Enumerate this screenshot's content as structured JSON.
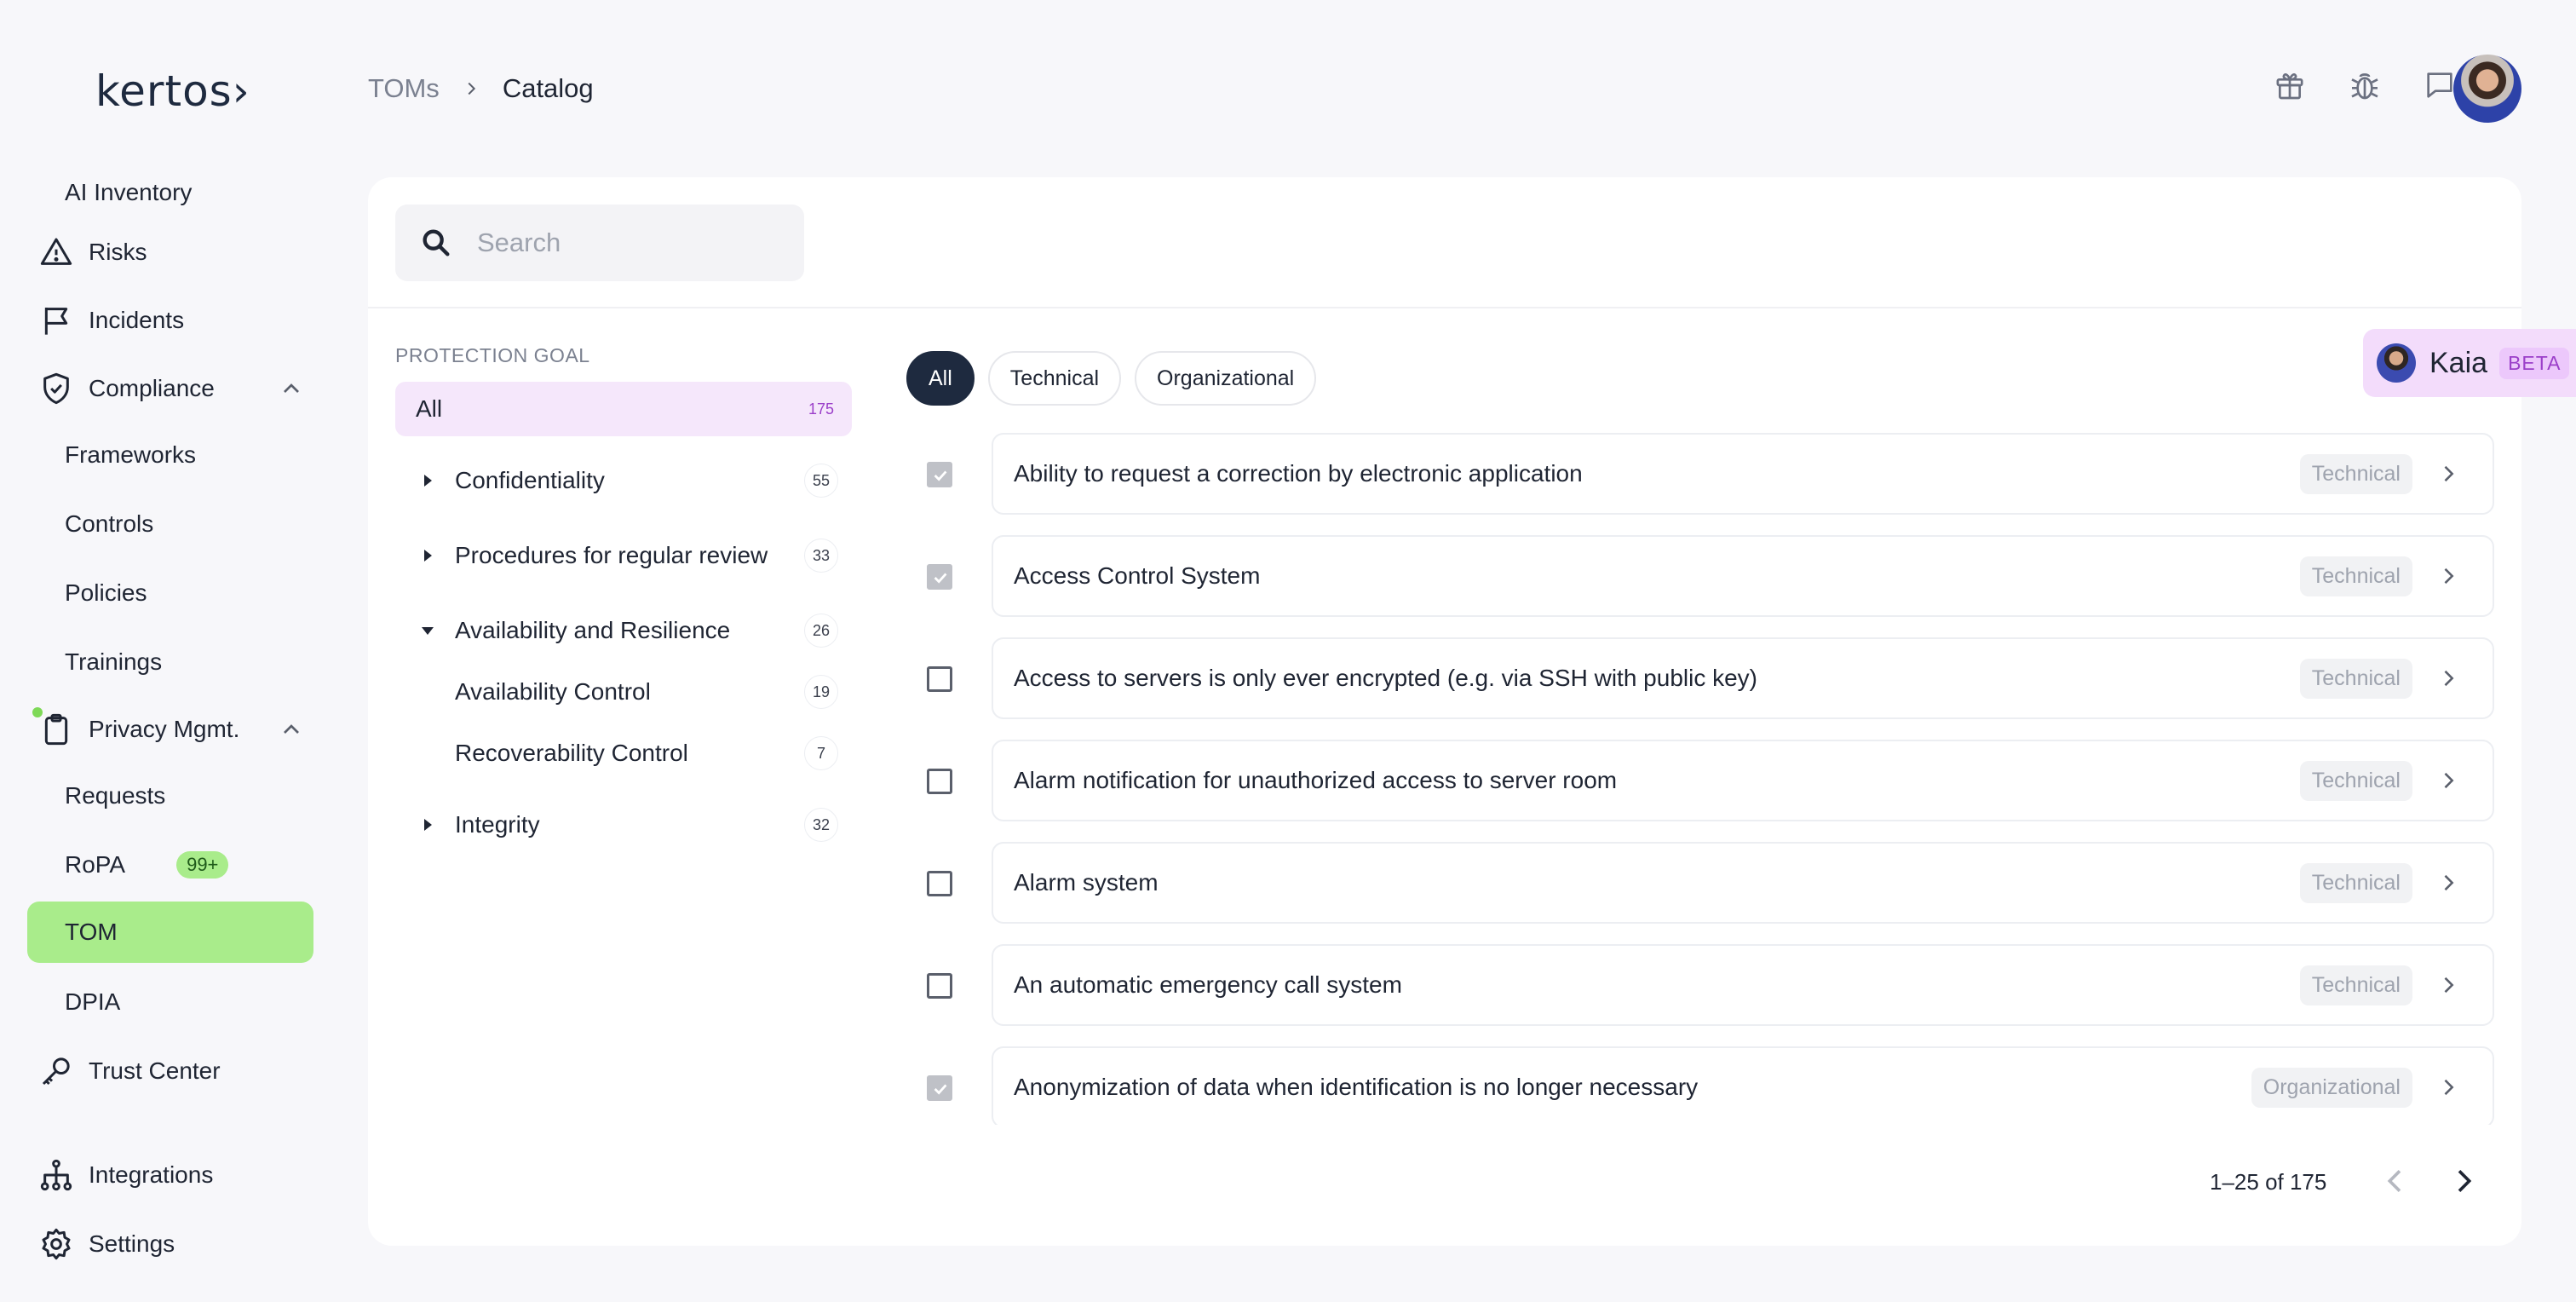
{
  "app": {
    "logo": "kertos›"
  },
  "sidebar": {
    "items": [
      {
        "label": "AI Inventory"
      },
      {
        "label": "Risks"
      },
      {
        "label": "Incidents"
      },
      {
        "label": "Compliance"
      },
      {
        "label": "Frameworks"
      },
      {
        "label": "Controls"
      },
      {
        "label": "Policies"
      },
      {
        "label": "Trainings"
      },
      {
        "label": "Privacy Mgmt."
      },
      {
        "label": "Requests"
      },
      {
        "label": "RoPA",
        "badge": "99+"
      },
      {
        "label": "TOM"
      },
      {
        "label": "DPIA"
      },
      {
        "label": "Trust Center"
      },
      {
        "label": "Integrations"
      },
      {
        "label": "Settings"
      }
    ]
  },
  "header": {
    "breadcrumb": [
      "TOMs",
      "Catalog"
    ]
  },
  "search": {
    "placeholder": "Search"
  },
  "filters": {
    "group_label": "PROTECTION GOAL",
    "tree": [
      {
        "label": "All",
        "count": "175"
      },
      {
        "label": "Confidentiality",
        "count": "55"
      },
      {
        "label": "Procedures for regular review",
        "count": "33"
      },
      {
        "label": "Availability and Resilience",
        "count": "26"
      },
      {
        "label": "Availability Control",
        "count": "19"
      },
      {
        "label": "Recoverability Control",
        "count": "7"
      },
      {
        "label": "Integrity",
        "count": "32"
      }
    ]
  },
  "type_chips": [
    "All",
    "Technical",
    "Organizational"
  ],
  "measures": [
    {
      "title": "Ability to request a correction by electronic application",
      "type": "Technical",
      "checked": true
    },
    {
      "title": "Access Control System",
      "type": "Technical",
      "checked": true
    },
    {
      "title": "Access to servers is only ever encrypted (e.g. via SSH with public key)",
      "type": "Technical",
      "checked": false
    },
    {
      "title": "Alarm notification for unauthorized access to server room",
      "type": "Technical",
      "checked": false
    },
    {
      "title": "Alarm system",
      "type": "Technical",
      "checked": false
    },
    {
      "title": "An automatic emergency call system",
      "type": "Technical",
      "checked": false
    },
    {
      "title": "Anonymization of data when identification is no longer necessary",
      "type": "Organizational",
      "checked": true
    }
  ],
  "pagination": {
    "range": "1–25 of 175"
  },
  "assistant": {
    "name": "Kaia",
    "badge": "BETA"
  },
  "colors": {
    "active_nav": "#a9ec8b",
    "selected_filter": "#f5e7fb",
    "dark_chip": "#1e2a3f"
  }
}
